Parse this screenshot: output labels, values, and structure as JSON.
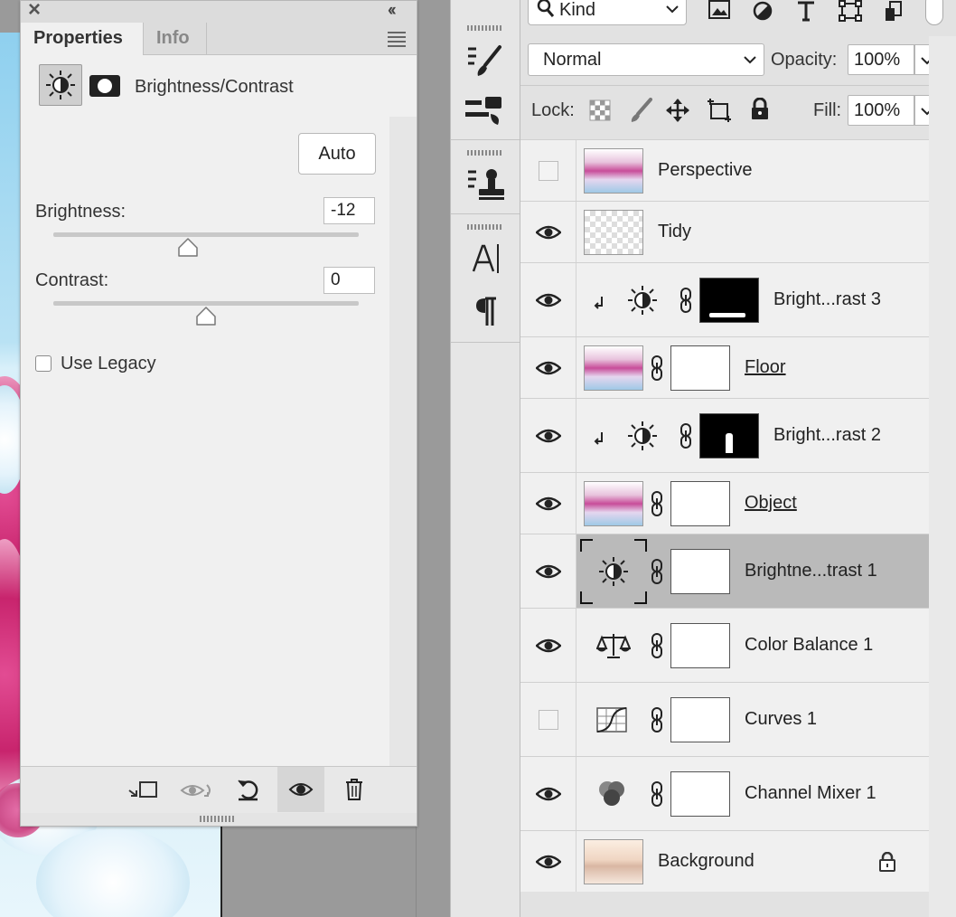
{
  "properties_panel": {
    "close_glyph": "×",
    "collapse_glyph": "‹‹",
    "tabs": [
      "Properties",
      "Info"
    ],
    "adjustment_title": "Brightness/Contrast",
    "auto_label": "Auto",
    "brightness_label": "Brightness:",
    "brightness_value": "-12",
    "brightness_fraction": 0.44,
    "contrast_label": "Contrast:",
    "contrast_value": "0",
    "contrast_fraction": 0.5,
    "use_legacy_label": "Use Legacy",
    "use_legacy_checked": false
  },
  "layers_panel": {
    "filter_kind_label": "Kind",
    "blend_mode": "Normal",
    "opacity_label": "Opacity:",
    "opacity_value": "100%",
    "lock_label": "Lock:",
    "fill_label": "Fill:",
    "fill_value": "100%",
    "layers": [
      {
        "name": "Perspective",
        "visible": false,
        "thumb": "image",
        "mask": false,
        "clipped": false,
        "underline": false
      },
      {
        "name": "Tidy",
        "visible": true,
        "thumb": "transparent",
        "mask": false,
        "clipped": false,
        "underline": false
      },
      {
        "name": "Bright...rast 3",
        "visible": true,
        "thumb": "brightness-icon",
        "mask": "black-mask",
        "clipped": true,
        "underline": false
      },
      {
        "name": "Floor",
        "visible": true,
        "thumb": "image",
        "mask": "white-mask",
        "clipped": false,
        "underline": true
      },
      {
        "name": "Bright...rast 2",
        "visible": true,
        "thumb": "brightness-icon",
        "mask": "black-mask-figure",
        "clipped": true,
        "underline": false
      },
      {
        "name": "Object",
        "visible": true,
        "thumb": "image",
        "mask": "white-mask",
        "clipped": false,
        "underline": true
      },
      {
        "name": "Brightne...trast 1",
        "visible": true,
        "thumb": "brightness-icon",
        "mask": "white-mask",
        "clipped": false,
        "underline": false,
        "selected": true
      },
      {
        "name": "Color Balance 1",
        "visible": true,
        "thumb": "balance-icon",
        "mask": "white-mask",
        "clipped": false,
        "underline": false
      },
      {
        "name": "Curves 1",
        "visible": false,
        "thumb": "curves-icon",
        "mask": "white-mask",
        "clipped": false,
        "underline": false
      },
      {
        "name": "Channel Mixer 1",
        "visible": true,
        "thumb": "mixer-icon",
        "mask": "white-mask",
        "clipped": false,
        "underline": false
      },
      {
        "name": "Background",
        "visible": true,
        "thumb": "background-image",
        "mask": false,
        "clipped": false,
        "underline": false,
        "locked": true
      }
    ]
  }
}
